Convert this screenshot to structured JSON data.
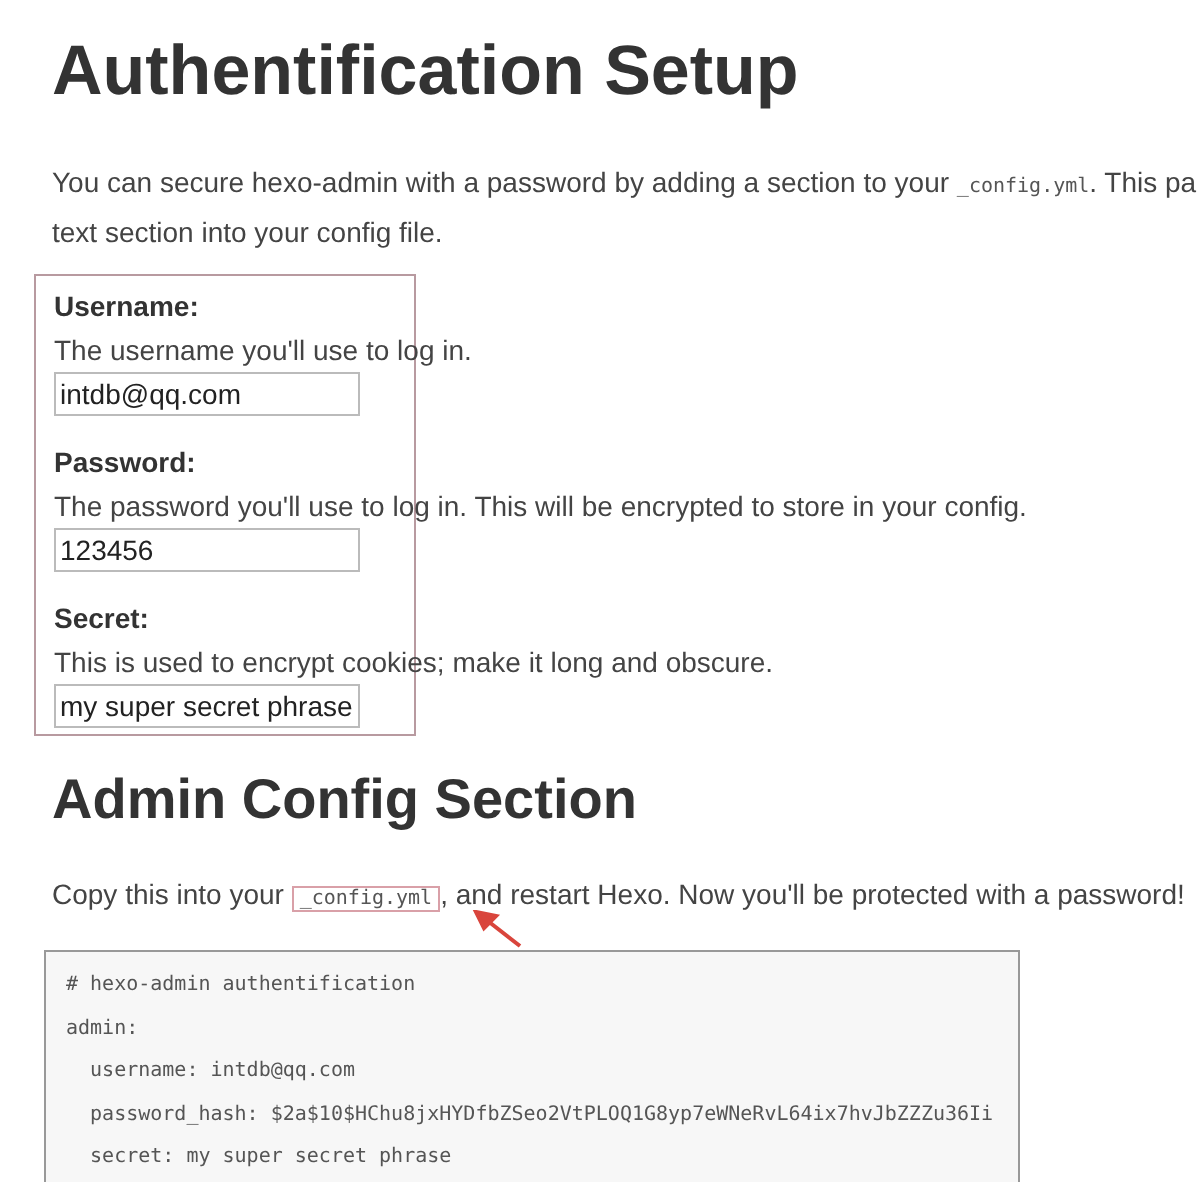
{
  "title": "Authentification Setup",
  "intro": {
    "before": "You can secure hexo-admin with a password by adding a section to your",
    "code": "_config.yml",
    "after": ". This pa",
    "line2": "text section into your config file."
  },
  "fields": [
    {
      "label": "Username:",
      "help": "The username you'll use to log in.",
      "value": "intdb@qq.com"
    },
    {
      "label": "Password:",
      "help": "The password you'll use to log in. This will be encrypted to store in your config.",
      "value": "123456"
    },
    {
      "label": "Secret:",
      "help": "This is used to encrypt cookies; make it long and obscure.",
      "value": "my super secret phrase"
    }
  ],
  "section_title": "Admin Config Section",
  "copy_text": {
    "before": "Copy this into your",
    "code": "_config.yml",
    "after": ", and restart Hexo. Now you'll be protected with a password!"
  },
  "code_lines": [
    "# hexo-admin authentification",
    "admin:",
    "  username: intdb@qq.com",
    "  password_hash: $2a$10$HChu8jxHYDfbZSeo2VtPLOQ1G8yp7eWNeRvL64ix7hvJbZZZu36Ii",
    "  secret: my super secret phrase"
  ]
}
